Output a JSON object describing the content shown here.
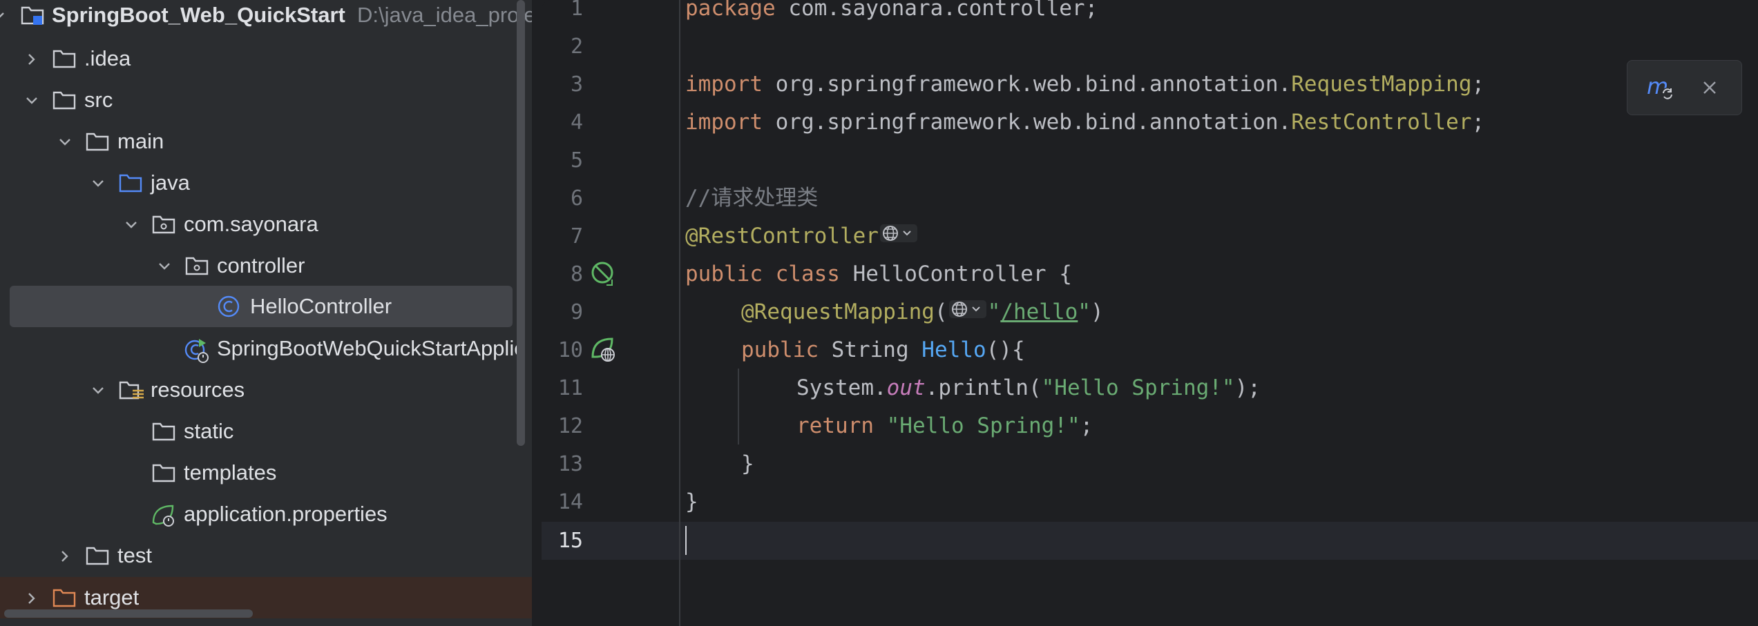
{
  "project": {
    "root": {
      "name": "SpringBoot_Web_QuickStart",
      "path": "D:\\java_idea_proje"
    },
    "items": [
      {
        "label": "SpringBoot_Web_QuickStart",
        "type": "module-root",
        "expanded": true
      },
      {
        "label": ".idea",
        "type": "folder",
        "expanded": false
      },
      {
        "label": "src",
        "type": "folder",
        "expanded": true
      },
      {
        "label": "main",
        "type": "folder",
        "expanded": true
      },
      {
        "label": "java",
        "type": "source-folder",
        "expanded": true
      },
      {
        "label": "com.sayonara",
        "type": "package",
        "expanded": true
      },
      {
        "label": "controller",
        "type": "package",
        "expanded": true
      },
      {
        "label": "HelloController",
        "type": "java-class",
        "selected": true
      },
      {
        "label": "SpringBootWebQuickStartApplic",
        "type": "spring-boot-app"
      },
      {
        "label": "resources",
        "type": "resources-folder",
        "expanded": true
      },
      {
        "label": "static",
        "type": "folder"
      },
      {
        "label": "templates",
        "type": "folder"
      },
      {
        "label": "application.properties",
        "type": "spring-properties"
      },
      {
        "label": "test",
        "type": "folder",
        "expanded": false
      },
      {
        "label": "target",
        "type": "excluded-folder",
        "expanded": false
      }
    ]
  },
  "editor": {
    "line_numbers": [
      "1",
      "2",
      "3",
      "4",
      "5",
      "6",
      "7",
      "8",
      "9",
      "10",
      "11",
      "12",
      "13",
      "14",
      "15"
    ],
    "current_line": 15,
    "code": {
      "l1_kw": "package",
      "l1_rest": " com.sayonara.controller;",
      "l3_kw": "import",
      "l3_pkg": " org.springframework.web.bind.annotation.",
      "l3_cls": "RequestMapping",
      "l3_end": ";",
      "l4_kw": "import",
      "l4_pkg": " org.springframework.web.bind.annotation.",
      "l4_cls": "RestController",
      "l4_end": ";",
      "l6_comment": "//请求处理类",
      "l7_ann": "@RestController",
      "l8_kw1": "public",
      "l8_kw2": " class",
      "l8_rest": " HelloController {",
      "l9_ann": "@RequestMapping",
      "l9_open": "(",
      "l9_q1": "\"",
      "l9_url": "/hello",
      "l9_q2": "\"",
      "l9_close": ")",
      "l10_kw": "public",
      "l10_type": " String ",
      "l10_fn": "Hello",
      "l10_end": "(){",
      "l11_obj": "System.",
      "l11_field": "out",
      "l11_call": ".println(",
      "l11_str": "\"Hello Spring!\"",
      "l11_end": ");",
      "l12_kw": "return",
      "l12_str": " \"Hello Spring!\"",
      "l12_end": ";",
      "l13": "}",
      "l14": "}"
    }
  },
  "popup": {
    "icon": "maven-reload-icon",
    "close_icon": "close-icon"
  },
  "colors": {
    "keyword": "#cf8e6d",
    "annotation": "#b3ae60",
    "string": "#6aab73",
    "comment": "#7a7e85",
    "function": "#56a8f5",
    "static_field": "#c77dbb",
    "selection": "#43454a"
  }
}
